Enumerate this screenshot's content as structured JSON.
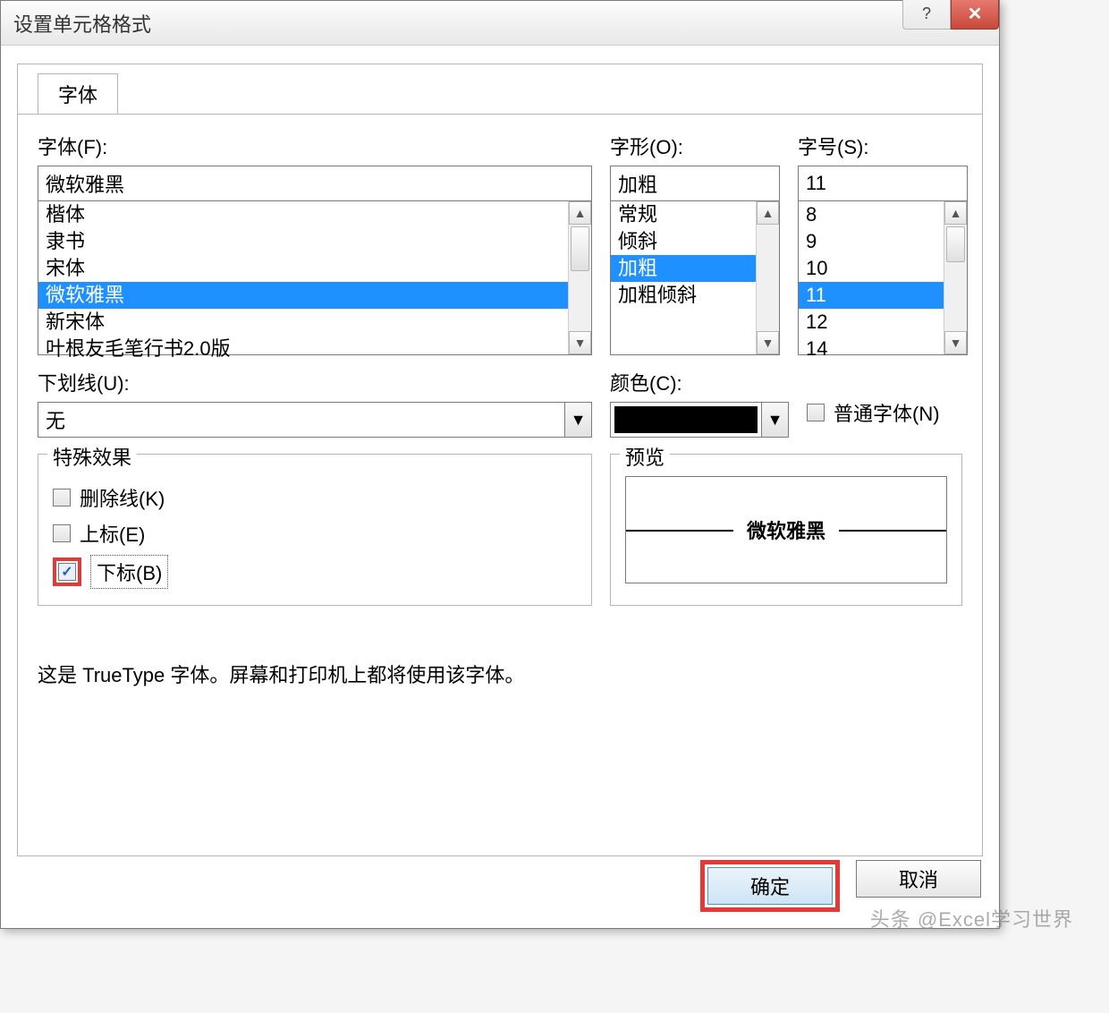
{
  "titlebar": {
    "title": "设置单元格格式"
  },
  "tab": {
    "label": "字体"
  },
  "font": {
    "label": "字体(F):",
    "value": "微软雅黑",
    "items": [
      "楷体",
      "隶书",
      "宋体",
      "微软雅黑",
      "新宋体",
      "叶根友毛笔行书2.0版"
    ],
    "selected_index": 3
  },
  "style": {
    "label": "字形(O):",
    "value": "加粗",
    "items": [
      "常规",
      "倾斜",
      "加粗",
      "加粗倾斜"
    ],
    "selected_index": 2
  },
  "size": {
    "label": "字号(S):",
    "value": "11",
    "items": [
      "8",
      "9",
      "10",
      "11",
      "12",
      "14"
    ],
    "selected_index": 3
  },
  "underline": {
    "label": "下划线(U):",
    "value": "无"
  },
  "color": {
    "label": "颜色(C):",
    "value": "#000000"
  },
  "normal_font": {
    "label": "普通字体(N)",
    "checked": false
  },
  "effects": {
    "label": "特殊效果",
    "strikethrough": {
      "label": "删除线(K)",
      "checked": false
    },
    "superscript": {
      "label": "上标(E)",
      "checked": false
    },
    "subscript": {
      "label": "下标(B)",
      "checked": true
    }
  },
  "preview": {
    "label": "预览",
    "text": "微软雅黑"
  },
  "note": "这是 TrueType 字体。屏幕和打印机上都将使用该字体。",
  "buttons": {
    "ok": "确定",
    "cancel": "取消"
  },
  "watermark": "头条 @Excel学习世界"
}
